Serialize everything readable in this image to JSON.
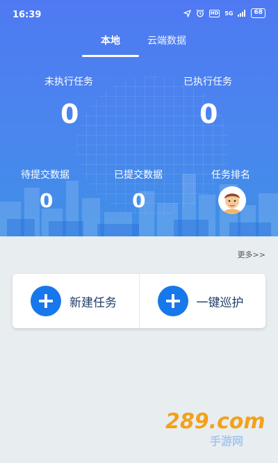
{
  "status_bar": {
    "time": "16:39",
    "network": "5G",
    "hd": "HD",
    "battery": "68"
  },
  "tabs": [
    {
      "label": "本地"
    },
    {
      "label": "云端数据"
    }
  ],
  "stats": {
    "unexecuted": {
      "label": "未执行任务",
      "value": "0"
    },
    "executed": {
      "label": "已执行任务",
      "value": "0"
    },
    "pending_submit": {
      "label": "待提交数据",
      "value": "0"
    },
    "submitted": {
      "label": "已提交数据",
      "value": "0"
    },
    "ranking": {
      "label": "任务排名"
    }
  },
  "more_link": "更多>>",
  "actions": [
    {
      "label": "新建任务",
      "icon": "plus-icon"
    },
    {
      "label": "一键巡护",
      "icon": "plus-icon"
    }
  ],
  "watermark": {
    "text": "289.com",
    "subtext": "手游网"
  },
  "colors": {
    "header": "#4f79f2",
    "accent": "#1877ea",
    "background": "#e8edf0"
  }
}
